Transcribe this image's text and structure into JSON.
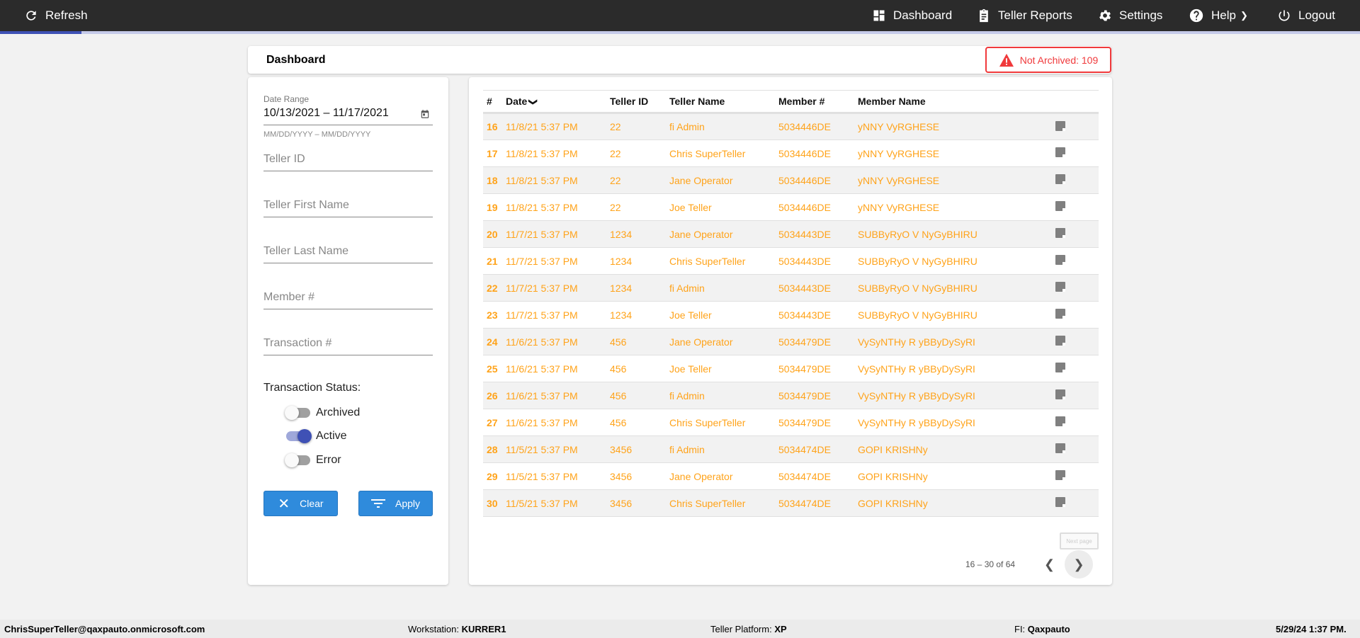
{
  "topbar": {
    "refresh": "Refresh",
    "nav": [
      {
        "label": "Dashboard",
        "icon": "dashboard-icon"
      },
      {
        "label": "Teller Reports",
        "icon": "clipboard-icon"
      },
      {
        "label": "Settings",
        "icon": "gear-icon"
      },
      {
        "label": "Help",
        "icon": "help-icon"
      },
      {
        "label": "Logout",
        "icon": "power-icon"
      }
    ]
  },
  "progress": {
    "percent": 6
  },
  "header": {
    "title": "Dashboard",
    "badge": "Not Archived: 109"
  },
  "filters": {
    "date_range_label": "Date Range",
    "date_range_value": "10/13/2021 – 11/17/2021",
    "date_hint": "MM/DD/YYYY – MM/DD/YYYY",
    "teller_id": "Teller ID",
    "first_name": "Teller First Name",
    "last_name": "Teller Last Name",
    "member": "Member #",
    "transaction": "Transaction #",
    "status_label": "Transaction Status:",
    "statuses": [
      {
        "label": "Archived",
        "on": false
      },
      {
        "label": "Active",
        "on": true
      },
      {
        "label": "Error",
        "on": false
      }
    ],
    "clear": "Clear",
    "apply": "Apply"
  },
  "table": {
    "headers": [
      "#",
      "Date",
      "Teller ID",
      "Teller Name",
      "Member #",
      "Member Name"
    ],
    "rows": [
      [
        "16",
        "11/8/21 5:37 PM",
        "22",
        "fi Admin",
        "5034446DE",
        "yNNY VyRGHESE"
      ],
      [
        "17",
        "11/8/21 5:37 PM",
        "22",
        "Chris SuperTeller",
        "5034446DE",
        "yNNY VyRGHESE"
      ],
      [
        "18",
        "11/8/21 5:37 PM",
        "22",
        "Jane Operator",
        "5034446DE",
        "yNNY VyRGHESE"
      ],
      [
        "19",
        "11/8/21 5:37 PM",
        "22",
        "Joe Teller",
        "5034446DE",
        "yNNY VyRGHESE"
      ],
      [
        "20",
        "11/7/21 5:37 PM",
        "1234",
        "Jane Operator",
        "5034443DE",
        "SUBByRyO V NyGyBHIRU"
      ],
      [
        "21",
        "11/7/21 5:37 PM",
        "1234",
        "Chris SuperTeller",
        "5034443DE",
        "SUBByRyO V NyGyBHIRU"
      ],
      [
        "22",
        "11/7/21 5:37 PM",
        "1234",
        "fi Admin",
        "5034443DE",
        "SUBByRyO V NyGyBHIRU"
      ],
      [
        "23",
        "11/7/21 5:37 PM",
        "1234",
        "Joe Teller",
        "5034443DE",
        "SUBByRyO V NyGyBHIRU"
      ],
      [
        "24",
        "11/6/21 5:37 PM",
        "456",
        "Jane Operator",
        "5034479DE",
        "VySyNTHy R yBByDySyRI"
      ],
      [
        "25",
        "11/6/21 5:37 PM",
        "456",
        "Joe Teller",
        "5034479DE",
        "VySyNTHy R yBByDySyRI"
      ],
      [
        "26",
        "11/6/21 5:37 PM",
        "456",
        "fi Admin",
        "5034479DE",
        "VySyNTHy R yBByDySyRI"
      ],
      [
        "27",
        "11/6/21 5:37 PM",
        "456",
        "Chris SuperTeller",
        "5034479DE",
        "VySyNTHy R yBByDySyRI"
      ],
      [
        "28",
        "11/5/21 5:37 PM",
        "3456",
        "fi Admin",
        "5034474DE",
        "GOPI KRISHNy"
      ],
      [
        "29",
        "11/5/21 5:37 PM",
        "3456",
        "Jane Operator",
        "5034474DE",
        "GOPI KRISHNy"
      ],
      [
        "30",
        "11/5/21 5:37 PM",
        "3456",
        "Chris SuperTeller",
        "5034474DE",
        "GOPI KRISHNy"
      ]
    ]
  },
  "pager": {
    "range": "16 – 30 of 64",
    "tooltip": "Next page"
  },
  "footer": {
    "user": "ChrisSuperTeller@qaxpauto.onmicrosoft.com",
    "workstation_label": "Workstation:",
    "workstation": "KURRER1",
    "platform_label": "Teller Platform:",
    "platform": "XP",
    "fi_label": "FI:",
    "fi": "Qaxpauto",
    "datetime": "5/29/24 1:37 PM."
  },
  "colors": {
    "accent": "#ffa31a",
    "primary": "#3f51b5",
    "button": "#2f8bdc",
    "alert": "#f0393b"
  }
}
